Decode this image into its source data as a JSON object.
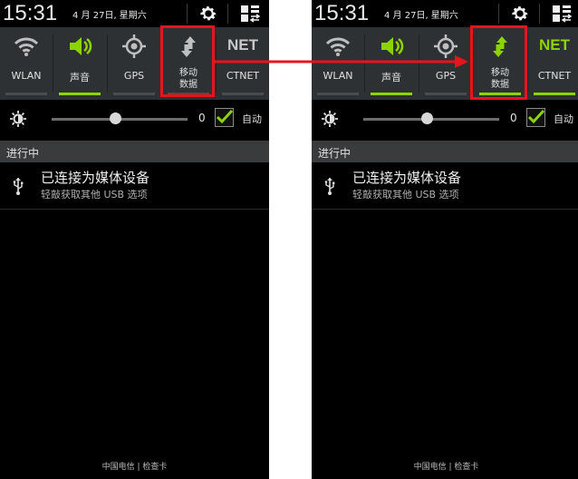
{
  "left": {
    "time": "15:31",
    "date": "4 月 27日, 星期六",
    "toggles": [
      {
        "label": "WLAN",
        "icon": "wifi-icon",
        "on": false
      },
      {
        "label": "声音",
        "icon": "speaker-icon",
        "on": true
      },
      {
        "label": "GPS",
        "icon": "gps-icon",
        "on": false
      },
      {
        "label": "移动\n数据",
        "label_line1": "移动",
        "label_line2": "数据",
        "icon": "mobile-data-icon",
        "on": false
      },
      {
        "label": "CTNET",
        "icon_text": "NET",
        "on": false
      }
    ],
    "brightness_value": "0",
    "auto_label": "自动",
    "ongoing_header": "进行中",
    "notification": {
      "title": "已连接为媒体设备",
      "subtitle": "轻敲获取其他 USB 选项"
    },
    "carrier": "中国电信 | 检查卡"
  },
  "right": {
    "time": "15:31",
    "date": "4 月 27日, 星期六",
    "toggles": [
      {
        "label": "WLAN",
        "icon": "wifi-icon",
        "on": false
      },
      {
        "label": "声音",
        "icon": "speaker-icon",
        "on": true
      },
      {
        "label": "GPS",
        "icon": "gps-icon",
        "on": false
      },
      {
        "label_line1": "移动",
        "label_line2": "数据",
        "icon": "mobile-data-icon",
        "on": true
      },
      {
        "label": "CTNET",
        "icon_text": "NET",
        "on": true
      }
    ],
    "brightness_value": "0",
    "auto_label": "自动",
    "ongoing_header": "进行中",
    "notification": {
      "title": "已连接为媒体设备",
      "subtitle": "轻敲获取其他 USB 选项"
    },
    "carrier": "中国电信 | 检查卡"
  },
  "colors": {
    "accent_green": "#8cd400",
    "highlight_red": "#e8141b",
    "panel_gray": "#2e3134"
  }
}
